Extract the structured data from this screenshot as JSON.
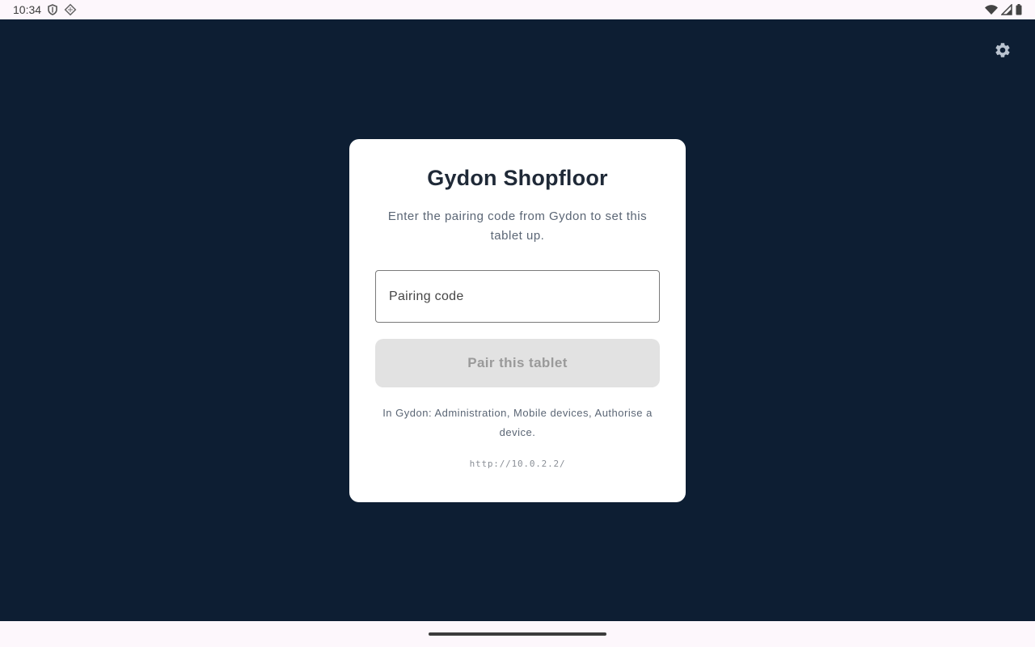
{
  "status_bar": {
    "time": "10:34",
    "icons_left": [
      "shield-icon",
      "diamond-icon"
    ],
    "icons_right": [
      "wifi-icon",
      "signal-icon",
      "battery-icon"
    ]
  },
  "settings": {
    "icon": "gear-icon",
    "color": "#b9c3d0"
  },
  "card": {
    "title": "Gydon Shopfloor",
    "subtitle": "Enter the pairing code from Gydon to set this tablet up.",
    "input_placeholder": "Pairing code",
    "input_value": "",
    "button_label": "Pair this tablet",
    "button_enabled": false,
    "hint": "In Gydon: Administration, Mobile devices, Authorise a device.",
    "server_url": "http://10.0.2.2/"
  },
  "colors": {
    "background": "#0d1e33",
    "card": "#ffffff",
    "title": "#1f2937",
    "muted_text": "#5b6675",
    "button_disabled_bg": "#e2e2e2",
    "button_disabled_text": "#9a9a9a"
  }
}
